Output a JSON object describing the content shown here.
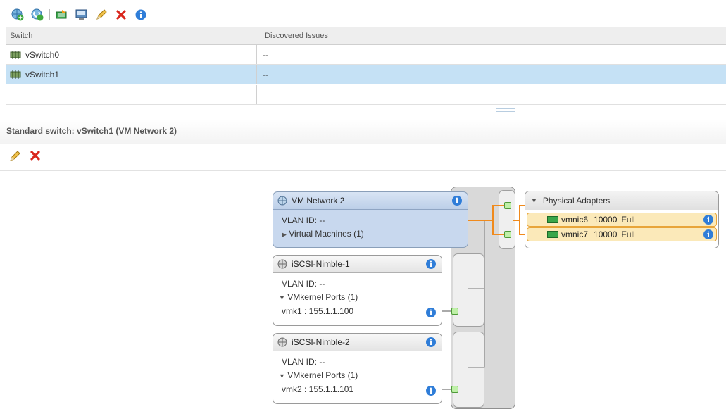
{
  "toolbar": {
    "icons": [
      "add-host-networking-icon",
      "refresh-icon",
      "migrate-adapter-icon",
      "view-settings-icon",
      "edit-icon",
      "remove-icon",
      "info-icon"
    ]
  },
  "grid": {
    "columns": [
      "Switch",
      "Discovered Issues"
    ],
    "rows": [
      {
        "switch": "vSwitch0",
        "issues": "--",
        "selected": false
      },
      {
        "switch": "vSwitch1",
        "issues": "--",
        "selected": true
      }
    ]
  },
  "detail": {
    "title": "Standard switch: vSwitch1 (VM Network 2)"
  },
  "topology": {
    "port_groups": [
      {
        "name": "VM Network 2",
        "vlan": "VLAN ID: --",
        "sub": "Virtual Machines (1)",
        "expanded": false,
        "port": ""
      },
      {
        "name": "iSCSI-Nimble-1",
        "vlan": "VLAN ID: --",
        "sub": "VMkernel Ports (1)",
        "expanded": true,
        "port": "vmk1 : 155.1.1.100"
      },
      {
        "name": "iSCSI-Nimble-2",
        "vlan": "VLAN ID: --",
        "sub": "VMkernel Ports (1)",
        "expanded": true,
        "port": "vmk2 : 155.1.1.101"
      }
    ],
    "physical_adapters": {
      "title": "Physical Adapters",
      "nics": [
        {
          "name": "vmnic6",
          "speed": "10000",
          "duplex": "Full"
        },
        {
          "name": "vmnic7",
          "speed": "10000",
          "duplex": "Full"
        }
      ]
    }
  },
  "colors": {
    "selected_row": "#c5e1f5",
    "info": "#2f7dd8",
    "link": "#f08a1c",
    "port": "#bff0a8"
  },
  "glyphs": {
    "info": "i",
    "expand": "▶",
    "collapse": "▼"
  }
}
